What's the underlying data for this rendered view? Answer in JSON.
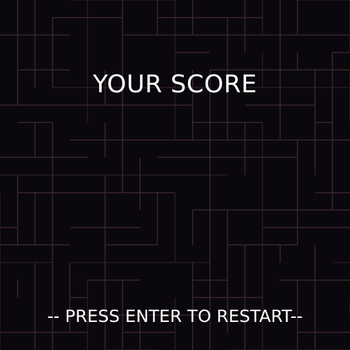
{
  "game_over_screen": {
    "title": "YOUR SCORE",
    "restart_prompt": "-- PRESS ENTER TO RESTART--"
  },
  "colors": {
    "background": "#0a080c",
    "maze_lines": "#3a2431",
    "text": "#ffffff"
  }
}
